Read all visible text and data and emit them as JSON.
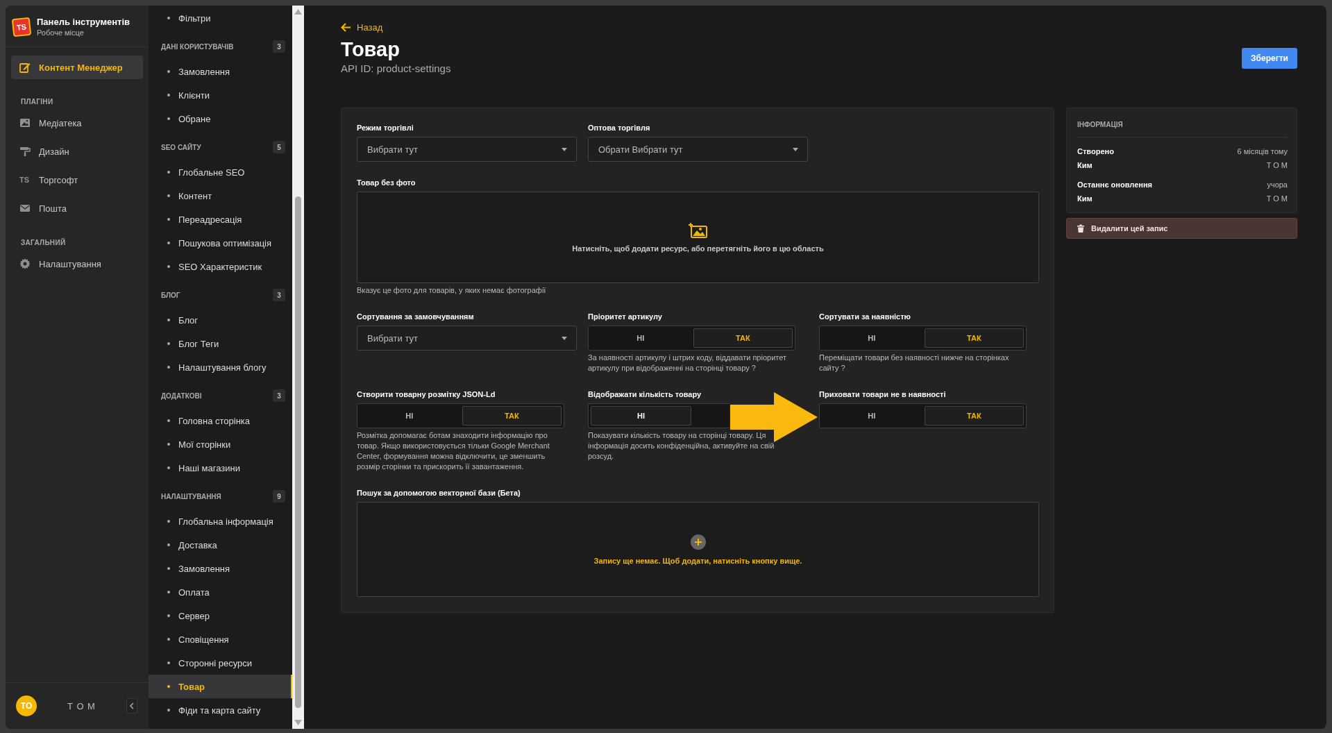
{
  "sidebar": {
    "logo_text": "TS",
    "title": "Панель інструментів",
    "subtitle": "Робоче місце",
    "sections": [
      {
        "items": [
          {
            "label": "Контент Менеджер",
            "selected": true
          }
        ]
      },
      {
        "heading": "ПЛАГІНИ",
        "items": [
          {
            "label": "Медіатека",
            "selected": false
          },
          {
            "label": "Дизайн",
            "selected": false
          },
          {
            "label": "Торгсофт",
            "icon_text": "TS",
            "selected": false
          },
          {
            "label": "Пошта",
            "selected": false
          }
        ]
      },
      {
        "heading": "ЗАГАЛЬНИЙ",
        "items": [
          {
            "label": "Налаштування",
            "selected": false
          }
        ]
      }
    ],
    "user": {
      "initials": "TO",
      "name": "T O M"
    }
  },
  "nav": {
    "groups": [
      {
        "items": [
          {
            "label": "Фільтри",
            "selected": false
          }
        ]
      },
      {
        "heading": "ДАНІ КОРИСТУВАЧІВ",
        "count": "3",
        "items": [
          {
            "label": "Замовлення",
            "selected": false
          },
          {
            "label": "Клієнти",
            "selected": false
          },
          {
            "label": "Обране",
            "selected": false
          }
        ]
      },
      {
        "heading": "SEO САЙТУ",
        "count": "5",
        "items": [
          {
            "label": "Глобальне SEO",
            "selected": false
          },
          {
            "label": "Контент",
            "selected": false
          },
          {
            "label": "Переадресація",
            "selected": false
          },
          {
            "label": "Пошукова оптимізація",
            "selected": false
          },
          {
            "label": "SEO Характеристик",
            "selected": false
          }
        ]
      },
      {
        "heading": "БЛОГ",
        "count": "3",
        "items": [
          {
            "label": "Блог",
            "selected": false
          },
          {
            "label": "Блог Теги",
            "selected": false
          },
          {
            "label": "Налаштування блогу",
            "selected": false
          }
        ]
      },
      {
        "heading": "ДОДАТКОВІ",
        "count": "3",
        "items": [
          {
            "label": "Головна сторінка",
            "selected": false
          },
          {
            "label": "Мої сторінки",
            "selected": false
          },
          {
            "label": "Наші магазини",
            "selected": false
          }
        ]
      },
      {
        "heading": "НАЛАШТУВАННЯ",
        "count": "9",
        "items": [
          {
            "label": "Глобальна інформація",
            "selected": false
          },
          {
            "label": "Доставка",
            "selected": false
          },
          {
            "label": "Замовлення",
            "selected": false
          },
          {
            "label": "Оплата",
            "selected": false
          },
          {
            "label": "Сервер",
            "selected": false
          },
          {
            "label": "Сповіщення",
            "selected": false
          },
          {
            "label": "Сторонні ресурси",
            "selected": false
          },
          {
            "label": "Товар",
            "selected": true
          },
          {
            "label": "Фіди та карта сайту",
            "selected": false
          }
        ]
      }
    ]
  },
  "page": {
    "back": "Назад",
    "title": "Товар",
    "api_id": "API ID: product-settings",
    "save": "Зберегти"
  },
  "form": {
    "rows": [
      {
        "fields": [
          {
            "kind": "select",
            "label": "Режим торгівлі",
            "placeholder": "Вибрати тут"
          },
          {
            "kind": "select",
            "label": "Оптова торгівля",
            "placeholder": "Обрати Вибрати тут"
          }
        ]
      },
      {
        "fields": [
          {
            "kind": "upload",
            "label": "Товар без фото",
            "text": "Натисніть, щоб додати ресурс, або перетягніть його в цю область",
            "hint": "Вказує це фото для товарів, у яких немає фотографії"
          }
        ]
      },
      {
        "fields": [
          {
            "kind": "select",
            "label": "Сортування за замовчуванням",
            "placeholder": "Вибрати тут"
          },
          {
            "kind": "toggle",
            "label": "Пріоритет артикулу",
            "options": [
              {
                "label": "НІ",
                "selected": false
              },
              {
                "label": "ТАК",
                "selected": true
              }
            ],
            "hint": "За наявності артикулу і штрих коду, віддавати пріоритет артикулу при відображенні на сторінці товару ?"
          },
          {
            "kind": "toggle",
            "label": "Сортувати за наявністю",
            "options": [
              {
                "label": "НІ",
                "selected": false
              },
              {
                "label": "ТАК",
                "selected": true
              }
            ],
            "hint": "Переміщати товари без наявності нижче на сторінках сайту ?"
          }
        ]
      },
      {
        "fields": [
          {
            "kind": "toggle",
            "label": "Створити товарну розмітку JSON-Ld",
            "options": [
              {
                "label": "НІ",
                "selected": false
              },
              {
                "label": "ТАК",
                "selected": true
              }
            ],
            "hint": "Розмітка допомагає ботам знаходити інформацію про товар. Якщо використовується тільки Google Merchant Center, формування можна відключити, це зменшить розмір сторінки та прискорить її завантаження."
          },
          {
            "kind": "toggle",
            "label": "Відображати кількість товару",
            "options": [
              {
                "label": "НІ",
                "selected": true
              }
            ],
            "hint": "Показувати кількість товару на сторінці товару. Ця інформація досить конфіденційна, активуйте на свій розсуд."
          },
          {
            "kind": "toggle",
            "label": "Приховати товари не в наявності",
            "options": [
              {
                "label": "НІ",
                "selected": false
              },
              {
                "label": "ТАК",
                "selected": true
              }
            ]
          }
        ]
      },
      {
        "fields": [
          {
            "kind": "relation",
            "label": "Пошук за допомогою векторної бази (Бета)",
            "text": "Запису ще немає. Щоб додати, натисніть кнопку вище."
          }
        ]
      }
    ]
  },
  "info": {
    "heading": "ІНФОРМАЦІЯ",
    "rows": [
      {
        "label": "Створено",
        "value": "6 місяців тому"
      },
      {
        "label": "Ким",
        "value": "T O M"
      },
      {
        "label": "Останнє оновлення",
        "value": "учора"
      },
      {
        "label": "Ким",
        "value": "T O M"
      }
    ],
    "delete": "Видалити цей запис"
  }
}
